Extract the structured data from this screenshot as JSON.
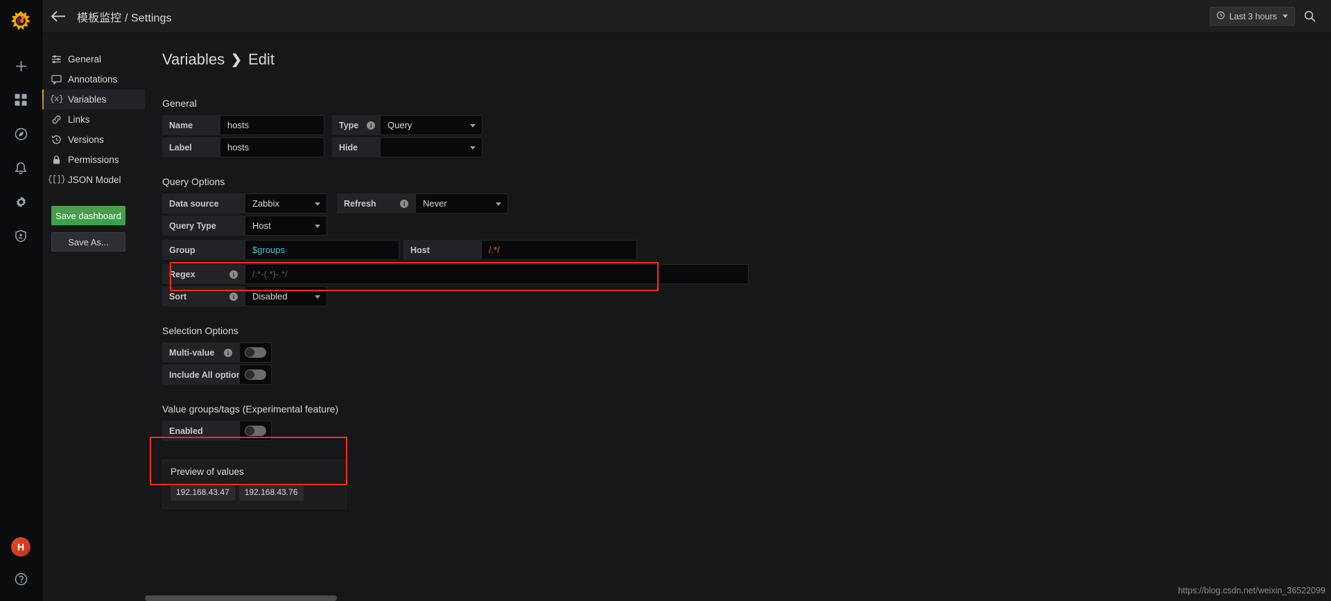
{
  "rail": {
    "logo_icon": "grafana-logo",
    "items": [
      {
        "icon": "plus-icon",
        "name": "create"
      },
      {
        "icon": "dashboards-icon",
        "name": "dashboards"
      },
      {
        "icon": "explore-compass-icon",
        "name": "explore"
      },
      {
        "icon": "bell-icon",
        "name": "alerting"
      },
      {
        "icon": "gear-icon",
        "name": "configuration"
      },
      {
        "icon": "shield-icon",
        "name": "server-admin"
      }
    ],
    "bottom": [
      {
        "icon": "user-avatar",
        "name": "profile",
        "initial": "H"
      },
      {
        "icon": "help-question-icon",
        "name": "help"
      }
    ]
  },
  "topbar": {
    "back_icon": "back-arrow-icon",
    "breadcrumb": "模板监控 / Settings",
    "time_range": "Last 3 hours",
    "clock_icon": "clock-icon",
    "search_icon": "search-icon"
  },
  "settings_nav": {
    "items": [
      {
        "label": "General",
        "icon": "sliders-icon",
        "active": false
      },
      {
        "label": "Annotations",
        "icon": "comment-icon",
        "active": false
      },
      {
        "label": "Variables",
        "icon": "variable-braces-icon",
        "active": true
      },
      {
        "label": "Links",
        "icon": "link-icon",
        "active": false
      },
      {
        "label": "Versions",
        "icon": "history-icon",
        "active": false
      },
      {
        "label": "Permissions",
        "icon": "lock-icon",
        "active": false
      },
      {
        "label": "JSON Model",
        "icon": "json-braces-icon",
        "active": false
      }
    ],
    "save_dashboard_label": "Save dashboard",
    "save_as_label": "Save As..."
  },
  "page": {
    "title_root": "Variables",
    "title_chevron": "❯",
    "title_current": "Edit"
  },
  "general": {
    "heading": "General",
    "name_label": "Name",
    "name_value": "hosts",
    "type_label": "Type",
    "type_value": "Query",
    "label_label": "Label",
    "label_value": "hosts",
    "hide_label": "Hide",
    "hide_value": ""
  },
  "query_options": {
    "heading": "Query Options",
    "datasource_label": "Data source",
    "datasource_value": "Zabbix",
    "refresh_label": "Refresh",
    "refresh_value": "Never",
    "querytype_label": "Query Type",
    "querytype_value": "Host",
    "group_label": "Group",
    "group_value": "$groups",
    "host_label": "Host",
    "host_value": "/.*/",
    "regex_label": "Regex",
    "regex_placeholder": "/.*-(.*)-.*/",
    "sort_label": "Sort",
    "sort_value": "Disabled"
  },
  "selection_options": {
    "heading": "Selection Options",
    "multivalue_label": "Multi-value",
    "multivalue_on": false,
    "includeall_label": "Include All option",
    "includeall_on": false
  },
  "value_groups": {
    "heading": "Value groups/tags (Experimental feature)",
    "enabled_label": "Enabled",
    "enabled_on": false
  },
  "preview": {
    "title": "Preview of values",
    "values": [
      "192.168.43.47",
      "192.168.43.76"
    ]
  },
  "watermark": "https://blog.csdn.net/weixin_36522099",
  "colors": {
    "accent_orange": "#f2a900",
    "highlight_red": "#ff2b16",
    "variable_cyan": "#4cc4d6",
    "regex_orange": "#e06c2b",
    "save_green": "#36a349"
  }
}
